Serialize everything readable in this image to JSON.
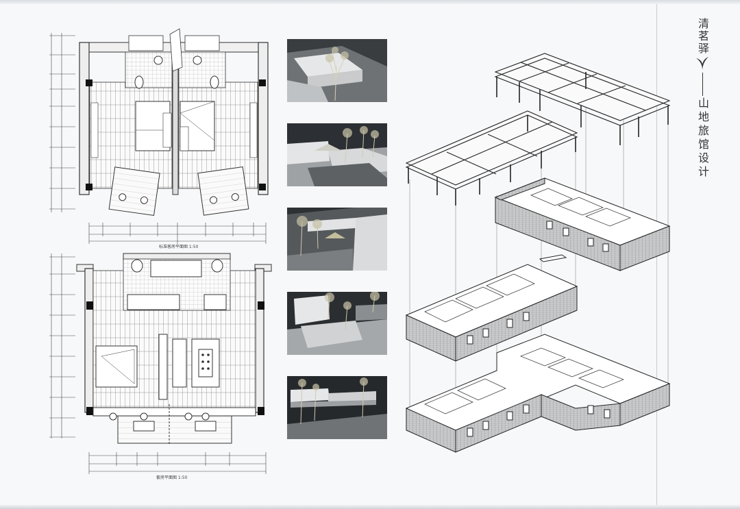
{
  "title": {
    "brand": "清茗驿",
    "subtitle": "山地旅馆设计"
  },
  "captions": {
    "plan_top": "标准客房平面图 1:50",
    "plan_bottom": "套房平面图 1:50"
  },
  "photos": [
    {
      "name": "model-photo-1"
    },
    {
      "name": "model-photo-2"
    },
    {
      "name": "model-photo-3"
    },
    {
      "name": "model-photo-4"
    },
    {
      "name": "model-photo-5"
    }
  ]
}
